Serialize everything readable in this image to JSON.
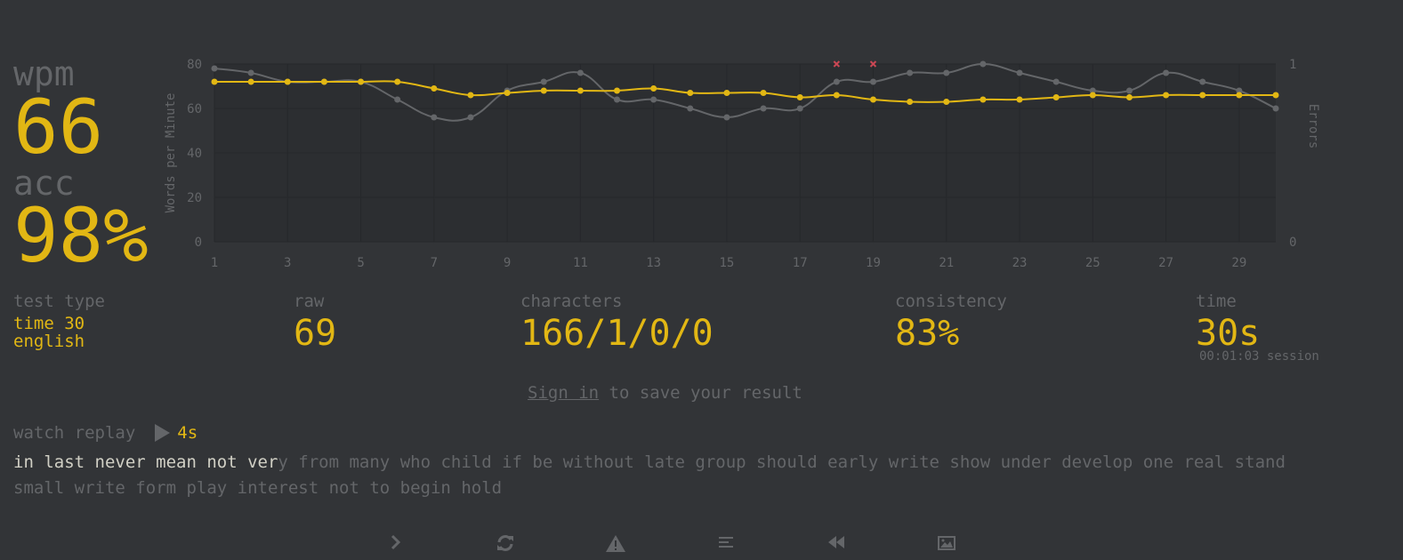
{
  "stats": {
    "wpm_label": "wpm",
    "wpm_value": "66",
    "acc_label": "acc",
    "acc_value": "98%"
  },
  "details": {
    "test_type_label": "test type",
    "test_type_mode": "time 30",
    "test_type_language": "english",
    "raw_label": "raw",
    "raw_value": "69",
    "characters_label": "characters",
    "characters_value": "166/1/0/0",
    "consistency_label": "consistency",
    "consistency_value": "83%",
    "time_label": "time",
    "time_value": "30s",
    "session_text": "00:01:03 session"
  },
  "signin": {
    "link": "Sign in",
    "rest": " to save your result"
  },
  "replay": {
    "label": "watch replay",
    "time": "4s"
  },
  "words": {
    "typed": "in last never mean not ver",
    "untyped": "y from many who child if be without late group should early write show under develop one real stand small write form play interest not to begin hold"
  },
  "bottom_buttons": [
    {
      "name": "next-test-button",
      "icon": "chevron-right-icon"
    },
    {
      "name": "restart-test-button",
      "icon": "refresh-icon"
    },
    {
      "name": "show-words-history-button",
      "icon": "warning-icon"
    },
    {
      "name": "words-history-button",
      "icon": "align-left-icon"
    },
    {
      "name": "watch-replay-button",
      "icon": "backward-icon"
    },
    {
      "name": "save-screenshot-button",
      "icon": "image-icon"
    }
  ],
  "colors": {
    "background": "#323437",
    "main": "#e2b714",
    "sub": "#646669",
    "text": "#d1d0c5",
    "error": "#ca4754"
  },
  "chart_data": {
    "type": "line",
    "ylabel": "Words per Minute",
    "y2label": "Errors",
    "x": [
      1,
      2,
      3,
      4,
      5,
      6,
      7,
      8,
      9,
      10,
      11,
      12,
      13,
      14,
      15,
      16,
      17,
      18,
      19,
      20,
      21,
      22,
      23,
      24,
      25,
      26,
      27,
      28,
      29,
      30
    ],
    "x_ticks": [
      "1",
      "3",
      "5",
      "7",
      "9",
      "11",
      "13",
      "15",
      "17",
      "19",
      "21",
      "23",
      "25",
      "27",
      "29"
    ],
    "ylim": [
      0,
      80
    ],
    "y_ticks": [
      "0",
      "20",
      "40",
      "60",
      "80"
    ],
    "y2lim": [
      0,
      1
    ],
    "y2_ticks": [
      "0",
      "1"
    ],
    "series": [
      {
        "name": "",
        "color": "#e2b714",
        "values": [
          72,
          72,
          72,
          72,
          72,
          72,
          69,
          66,
          67,
          68,
          68,
          68,
          69,
          67,
          67,
          67,
          65,
          66,
          64,
          63,
          63,
          64,
          64,
          65,
          66,
          65,
          66,
          66,
          66,
          66
        ]
      },
      {
        "name": "",
        "color": "#646669",
        "values": [
          78,
          76,
          72,
          72,
          72,
          64,
          56,
          56,
          68,
          72,
          76,
          64,
          64,
          60,
          56,
          60,
          60,
          72,
          72,
          76,
          76,
          80,
          76,
          72,
          68,
          68,
          76,
          72,
          68,
          60
        ]
      }
    ],
    "errors": [
      {
        "x": 18,
        "count": 1
      },
      {
        "x": 19,
        "count": 1
      }
    ],
    "grid": true
  }
}
